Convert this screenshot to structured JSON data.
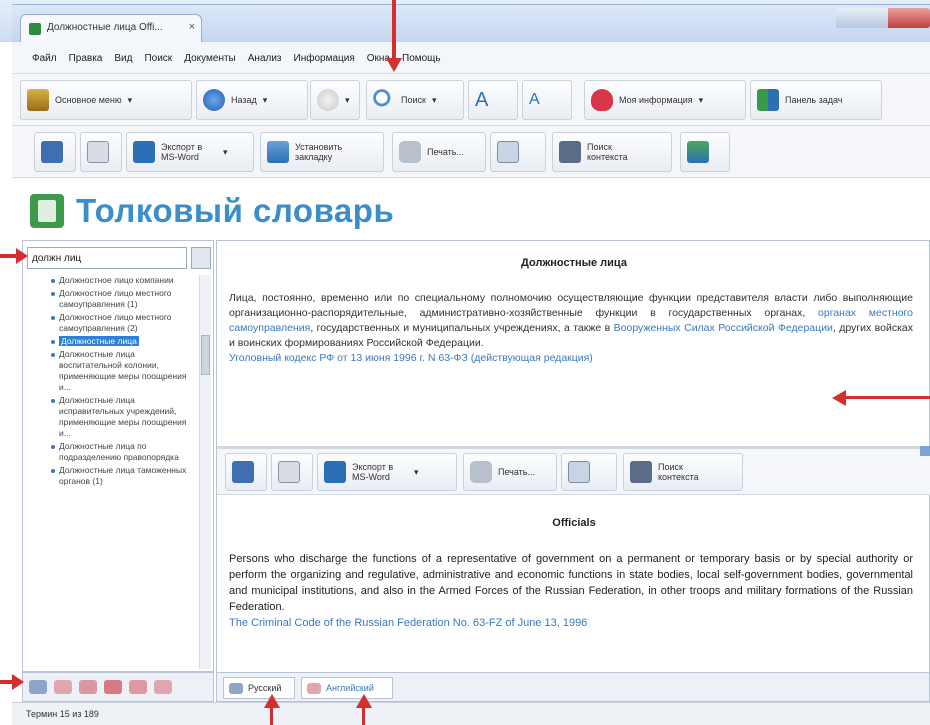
{
  "window": {
    "tab_title": "Должностные лица Offi...",
    "tab_close": "×"
  },
  "menu": [
    "Файл",
    "Правка",
    "Вид",
    "Поиск",
    "Документы",
    "Анализ",
    "Информация",
    "Окна",
    "Помощь"
  ],
  "toolbar1": {
    "main_menu": "Основное меню",
    "back": "Назад",
    "search": "Поиск",
    "font_up": "A",
    "font_down": "A",
    "my_info": "Моя информация",
    "taskbar": "Панель задач"
  },
  "toolbar2": {
    "export": "Экспорт в MS-Word",
    "bookmark": "Установить закладку",
    "print": "Печать...",
    "context_search": "Поиск контекста"
  },
  "page_title": "Толковый словарь",
  "left": {
    "search_value": "должн лиц",
    "tree": [
      "Должностное лицо компании",
      "Должностное лицо местного самоуправления (1)",
      "Должностное лицо местного самоуправления (2)",
      "Должностные лица",
      "Должностные лица воспитательной колонии, применяющие меры поощрения и...",
      "Должностные лица исправительных учреждений, применяющие меры поощрения и...",
      "Должностные лица по подразделению правопорядка",
      "Должностные лица таможенных органов (1)"
    ],
    "selected_index": 3
  },
  "ru": {
    "title": "Должностные лица",
    "text_1": "Лица, постоянно, временно или по специальному полномочию осуществляющие функции представителя власти либо выполняющие организационно-распорядительные, административно-хозяйственные функции в государственных органах, ",
    "link_1": "органах местного самоуправления",
    "text_2": ", государственных и муниципальных учреждениях, а также в ",
    "link_2": "Вооруженных Силах Российской Федерации",
    "text_3": ", других войсках и воинских формированиях Российской Федерации.",
    "source": "Уголовный кодекс РФ от 13 июня 1996 г. N 63-ФЗ (действующая редакция)"
  },
  "toolbar3": {
    "export": "Экспорт в MS-Word",
    "print": "Печать...",
    "context_search": "Поиск контекста"
  },
  "en": {
    "title": "Officials",
    "text": "Persons who discharge the functions of a representative of government on a permanent or temporary basis or by special authority or perform the organizing and regulative, administrative and economic functions in state bodies, local self-government bodies, governmental and municipal institutions, and also in the Armed Forces of the Russian Federation, in other troops and military formations of the Russian Federation.",
    "source": "The Criminal Code of the Russian Federation No. 63-FZ of June 13, 1996"
  },
  "lang_tabs": [
    "Русский",
    "Английский"
  ],
  "status": "Термин 15 из 189",
  "colors": {
    "accent_blue": "#3a8ec9",
    "link": "#3a78c0",
    "arrow": "#d23030"
  }
}
